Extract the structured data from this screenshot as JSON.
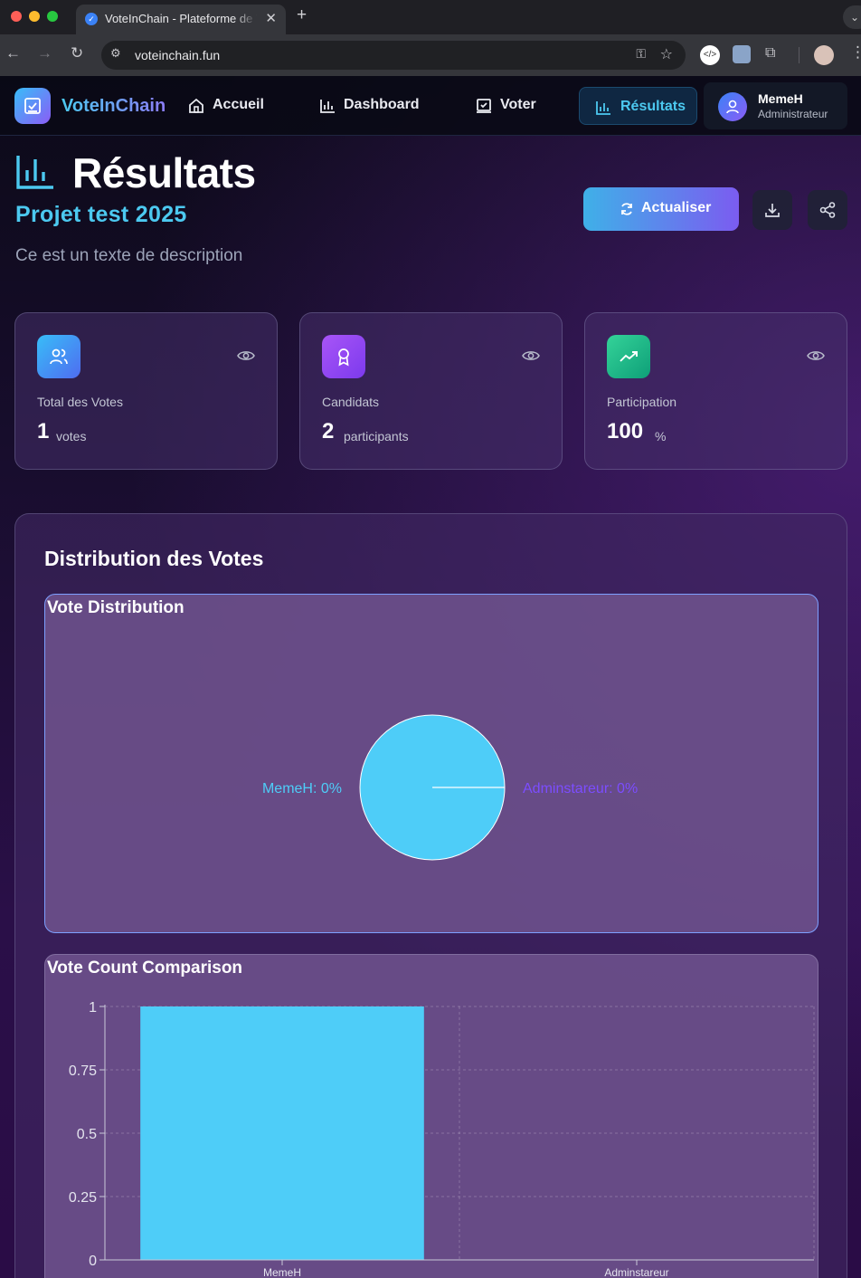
{
  "browser": {
    "tab_title": "VoteInChain - Plateforme de Vote",
    "url": "voteinchain.fun",
    "tab_favicon": "checkbox-icon"
  },
  "nav": {
    "brand": "VoteInChain",
    "items": [
      {
        "label": "Accueil",
        "icon": "home-icon"
      },
      {
        "label": "Dashboard",
        "icon": "bar-chart-icon"
      },
      {
        "label": "Voter",
        "icon": "vote-icon"
      },
      {
        "label": "Résultats",
        "icon": "bar-chart-icon",
        "active": true
      }
    ],
    "user": {
      "name": "MemeH",
      "role": "Administrateur"
    }
  },
  "header": {
    "title": "Résultats",
    "project": "Projet test 2025",
    "description": "Ce est un texte de description",
    "refresh_label": "Actualiser"
  },
  "stats": [
    {
      "label": "Total des Votes",
      "value": "1",
      "unit": "votes",
      "icon": "users-icon",
      "color": "#3b82f6"
    },
    {
      "label": "Candidats",
      "value": "2",
      "unit": "participants",
      "icon": "award-icon",
      "color": "#8b5cf6"
    },
    {
      "label": "Participation",
      "value": "100",
      "unit": "%",
      "icon": "trending-up-icon",
      "color": "#10b981"
    }
  ],
  "distribution": {
    "section_title": "Distribution des Votes",
    "pie_title": "Vote Distribution",
    "bar_title": "Vote Count Comparison"
  },
  "colors": {
    "accent": "#4cc9f0",
    "purple": "#8b5cf6",
    "series_1": "#4ecdf8",
    "series_2": "#7c4dff"
  },
  "chart_data": [
    {
      "type": "pie",
      "title": "Vote Distribution",
      "categories": [
        "MemeH",
        "Adminstareur"
      ],
      "values": [
        1,
        0
      ],
      "slice_labels": [
        "MemeH: 0%",
        "Adminstareur: 0%"
      ],
      "colors": [
        "#4ecdf8",
        "#7c4dff"
      ]
    },
    {
      "type": "bar",
      "title": "Vote Count Comparison",
      "categories": [
        "MemeH",
        "Adminstareur"
      ],
      "values": [
        1,
        0
      ],
      "ylim": [
        0,
        1
      ],
      "yticks": [
        "0",
        "0.25",
        "0.5",
        "0.75",
        "1"
      ],
      "grid": true,
      "colors": [
        "#4ecdf8"
      ]
    }
  ]
}
